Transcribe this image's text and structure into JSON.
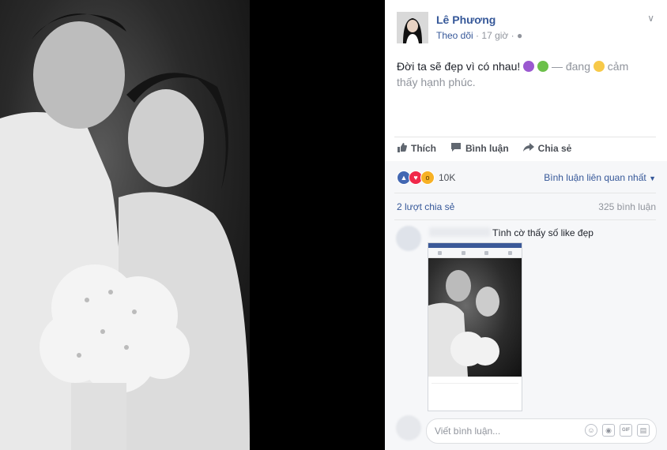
{
  "post": {
    "author": "Lê Phương",
    "follow_label": "Theo dõi",
    "time": "17 giờ",
    "status_text": "Đời ta sẽ đẹp vì có nhau!",
    "mood_prefix": "— đang",
    "mood_text": "cảm thấy hạnh phúc."
  },
  "actions": {
    "like": "Thích",
    "comment": "Bình luận",
    "share": "Chia sẻ"
  },
  "stats": {
    "reactions_count": "10K",
    "sort_label": "Bình luận liên quan nhất",
    "shares": "2 lượt chia sẻ",
    "comments": "325 bình luận"
  },
  "comment": {
    "text": "Tình cờ thấy số like đẹp"
  },
  "reply": {
    "placeholder": "Viết bình luận..."
  },
  "icons": {
    "like": "thumbs-up-icon",
    "love": "heart-icon",
    "wow": "wow-icon",
    "emoji": "smiley-icon",
    "camera": "camera-icon",
    "gif": "GIF",
    "sticker": "sticker-icon"
  },
  "colors": {
    "link": "#365899",
    "like_blue": "#4267b2",
    "love_red": "#f0284a",
    "wow_yellow": "#f7b125"
  }
}
